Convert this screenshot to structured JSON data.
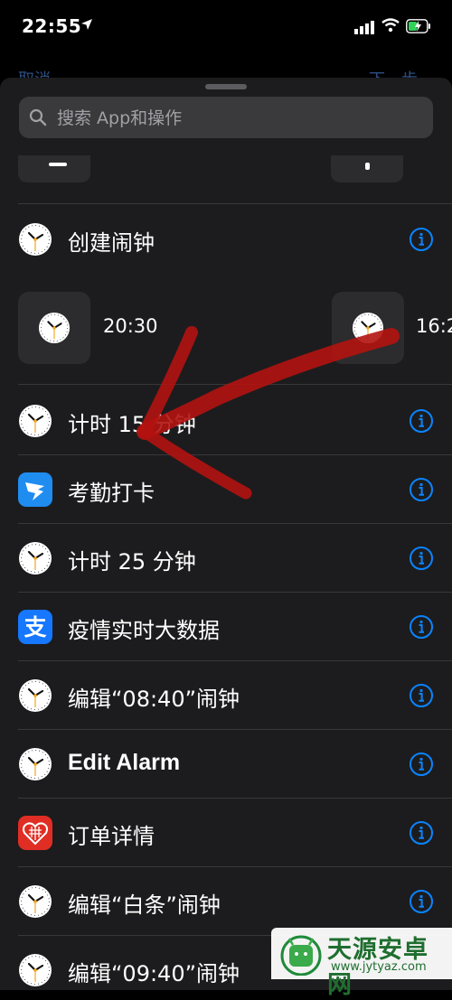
{
  "status_bar": {
    "time": "22:55",
    "location_arrow": "location-arrow-icon"
  },
  "nav_behind": {
    "left": "取消",
    "right": "下一步"
  },
  "search": {
    "placeholder": "搜索 App和操作"
  },
  "actions": [
    {
      "label": "创建闹钟",
      "icon": "clock-icon"
    },
    {
      "label": "计时 15 分钟",
      "icon": "clock-icon"
    },
    {
      "label": "考勤打卡",
      "icon": "dingtalk-icon"
    },
    {
      "label": "计时 25 分钟",
      "icon": "clock-icon"
    },
    {
      "label": "疫情实时大数据",
      "icon": "alipay-icon"
    },
    {
      "label": "编辑“08:40”闹钟",
      "icon": "clock-icon"
    },
    {
      "label": "Edit Alarm",
      "icon": "clock-icon"
    },
    {
      "label": "订单详情",
      "icon": "pinduoduo-icon"
    },
    {
      "label": "编辑“白条”闹钟",
      "icon": "clock-icon"
    },
    {
      "label": "编辑“09:40”闹钟",
      "icon": "clock-icon"
    }
  ],
  "alarm_suggestions": [
    {
      "time": "20:30"
    },
    {
      "time": "16:2"
    }
  ],
  "watermark": {
    "title": "天源安卓网",
    "url": "www.jytyaz.com"
  },
  "colors": {
    "accent": "#0a84ff",
    "annotation": "#b3130f"
  }
}
